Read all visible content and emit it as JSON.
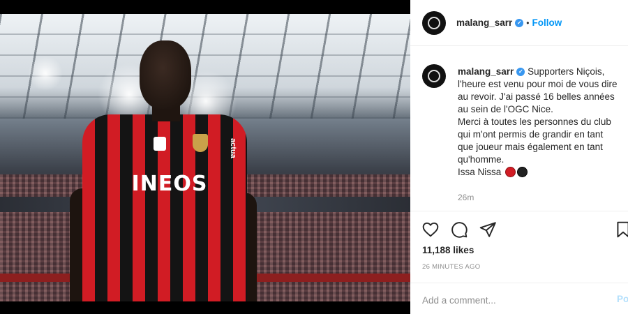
{
  "post": {
    "username": "malang_sarr",
    "follow_label": "Follow",
    "separator": "•",
    "caption_lines": [
      "Supporters Niçois,",
      "l'heure est venu pour moi de vous dire",
      "au revoir. J'ai passé 16 belles années",
      "au sein de l'OGC Nice.",
      "Merci à toutes les personnes du club",
      "qui m'ont permis de grandir en tant",
      "que joueur mais également en tant",
      "qu'homme.",
      "Issa Nissa"
    ],
    "time_short": "26m",
    "likes": "11,188 likes",
    "time_long": "26 MINUTES AGO",
    "comment_placeholder": "Add a comment...",
    "post_label": "Po",
    "sponsor_text": "INEOS",
    "sleeve_text": "actua"
  },
  "colors": {
    "accent": "#0095f6",
    "verified": "#3897f0",
    "emoji_red": "#d11c24",
    "emoji_black": "#222222"
  },
  "icons": [
    "verified-badge-icon",
    "heart-icon",
    "comment-icon",
    "share-icon",
    "bookmark-icon"
  ]
}
